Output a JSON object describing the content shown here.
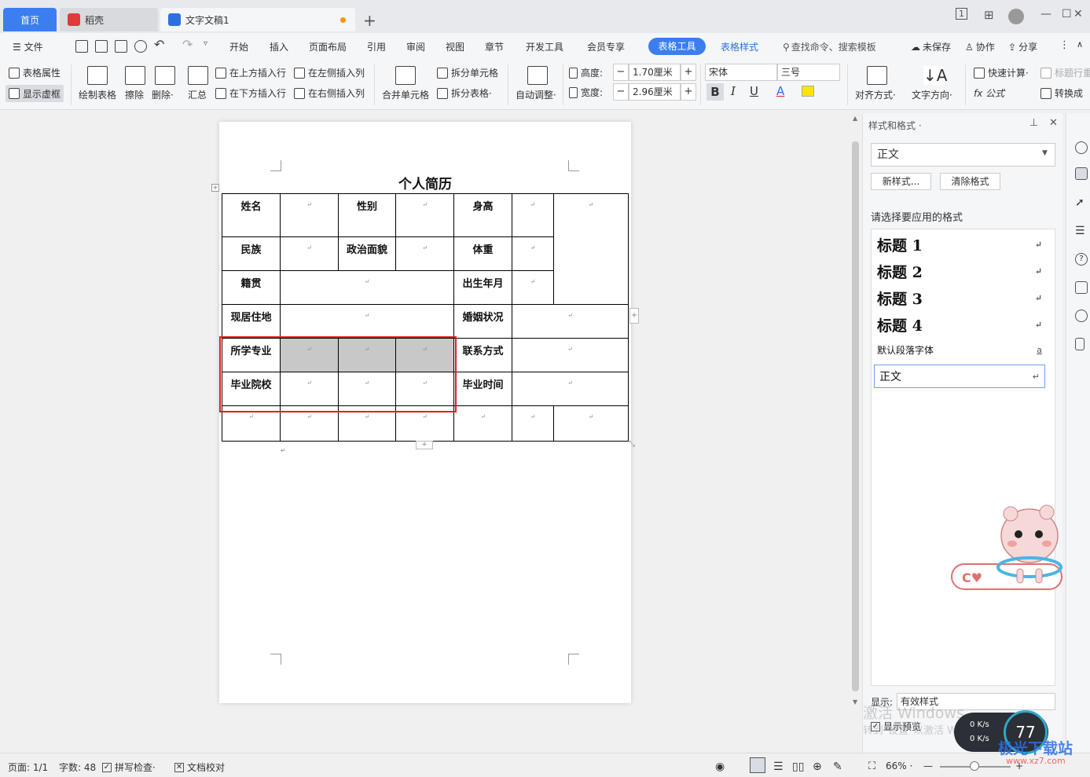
{
  "tabs": {
    "home": "首页",
    "daoke": "稻壳",
    "doc": "文字文稿1",
    "add": "+"
  },
  "window": {
    "badge": "1",
    "min": "—",
    "max": "☐",
    "close": "✕"
  },
  "menu": {
    "file": "☰ 文件",
    "items": [
      "开始",
      "插入",
      "页面布局",
      "引用",
      "审阅",
      "视图",
      "章节",
      "开发工具",
      "会员专享"
    ],
    "active": "表格工具",
    "table_style": "表格样式",
    "search": "查找命令、搜索模板",
    "unsaved": "未保存",
    "collab": "协作",
    "share": "分享",
    "more": "⋮",
    "collapse": "∧"
  },
  "ribbon": {
    "table_props": "表格属性",
    "show_grid": "显示虚框",
    "draw_table": "绘制表格",
    "erase": "擦除",
    "delete": "删除·",
    "summary": "汇总",
    "insert_above": "在上方插入行",
    "insert_below": "在下方插入行",
    "insert_left": "在左侧插入列",
    "insert_right": "在右侧插入列",
    "merge": "合并单元格",
    "split_cell": "拆分单元格",
    "split_table": "拆分表格·",
    "auto_adjust": "自动调整·",
    "height_label": "高度:",
    "height_value": "1.70厘米",
    "width_label": "宽度:",
    "width_value": "2.96厘米",
    "font": "宋体",
    "font_size": "三号",
    "bold": "B",
    "italic": "I",
    "underline": "U",
    "font_color": "A",
    "align": "对齐方式·",
    "text_dir": "文字方向·",
    "quick_calc": "快速计算·",
    "title_repeat": "标题行重复",
    "formula": "fx 公式",
    "convert": "转换成"
  },
  "document": {
    "title": "个人简历",
    "para_mark": "↵",
    "rows": [
      [
        "姓名",
        "",
        "性别",
        "",
        "身高",
        "",
        ""
      ],
      [
        "民族",
        "",
        "政治面貌",
        "",
        "体重",
        ""
      ],
      [
        "籍贯",
        "",
        "出生年月",
        ""
      ],
      [
        "现居住地",
        "",
        "婚姻状况",
        ""
      ],
      [
        "所学专业",
        "",
        "",
        "",
        "联系方式",
        ""
      ],
      [
        "毕业院校",
        "",
        "",
        "",
        "毕业时间",
        ""
      ],
      [
        "",
        "",
        "",
        "",
        "",
        "",
        ""
      ]
    ]
  },
  "panel": {
    "title": "样式和格式 ·",
    "current_style": "正文",
    "new_style": "新样式...",
    "clear_format": "清除格式",
    "pick_label": "请选择要应用的格式",
    "styles": [
      "标题 1",
      "标题 2",
      "标题 3",
      "标题 4",
      "默认段落字体",
      "正文"
    ],
    "show_label": "显示:",
    "show_value": "有效样式",
    "preview": "显示预览",
    "pin": "⊥",
    "close": "✕"
  },
  "status": {
    "page": "页面: 1/1",
    "words": "字数: 48",
    "spell": "拼写检查·",
    "proof": "文档校对",
    "zoom": "66% ·",
    "zoom_minus": "—",
    "zoom_plus": "+"
  },
  "overlay": {
    "activate": "激活 Windows",
    "activate_sub": "转到\"设置\"以激活 Windows。",
    "net_up": "0 K/s",
    "net_down": "0 K/s",
    "cpu": "77",
    "site": "极光下载站",
    "url": "www.xz7.com"
  },
  "colors": {
    "accent": "#3b7ef0",
    "selection": "#c8c8c8",
    "highlight_box": "#e02020"
  },
  "icons": [
    "daoke-icon",
    "doc-icon",
    "save-icon",
    "print-icon",
    "undo-icon",
    "redo-icon",
    "search-icon",
    "cloud-icon",
    "user-icon",
    "share-icon",
    "pin-icon",
    "close-icon"
  ]
}
